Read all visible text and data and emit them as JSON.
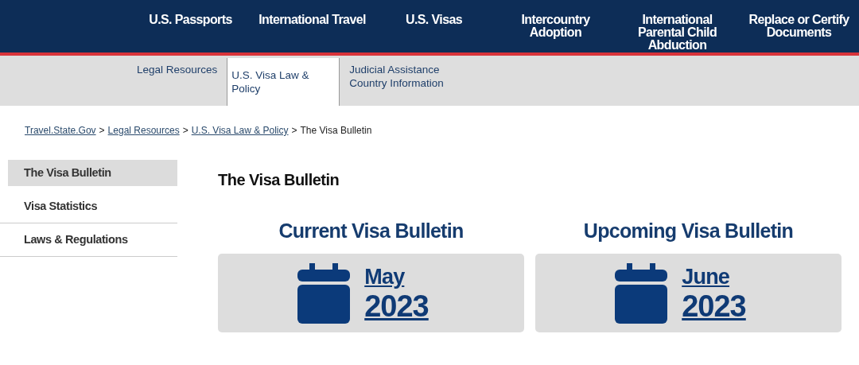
{
  "top_nav": [
    "U.S. Passports",
    "International Travel",
    "U.S. Visas",
    "Intercountry Adoption",
    "International Parental Child Abduction",
    "Replace or Certify Documents"
  ],
  "sub_nav": [
    {
      "label": "Legal Resources",
      "selected": false
    },
    {
      "label": "U.S. Visa Law & Policy",
      "selected": true
    },
    {
      "label": "Judicial Assistance Country Information",
      "selected": false
    }
  ],
  "breadcrumb": [
    {
      "label": "Travel.State.Gov",
      "kind": "link"
    },
    {
      "label": ">",
      "kind": "separator"
    },
    {
      "label": "Legal Resources",
      "kind": "link"
    },
    {
      "label": ">",
      "kind": "separator"
    },
    {
      "label": "U.S. Visa Law & Policy",
      "kind": "link"
    },
    {
      "label": ">",
      "kind": "separator"
    },
    {
      "label": "The Visa Bulletin",
      "kind": "current"
    }
  ],
  "sidebar": {
    "items": [
      {
        "label": "The Visa Bulletin",
        "selected": true
      },
      {
        "label": "Visa Statistics",
        "selected": false
      },
      {
        "label": "Laws & Regulations",
        "selected": false
      }
    ]
  },
  "page_title": "The Visa Bulletin",
  "bulletins": [
    {
      "heading": "Current Visa Bulletin",
      "month": "May",
      "year": "2023"
    },
    {
      "heading": "Upcoming Visa Bulletin",
      "month": "June",
      "year": "2023"
    }
  ]
}
